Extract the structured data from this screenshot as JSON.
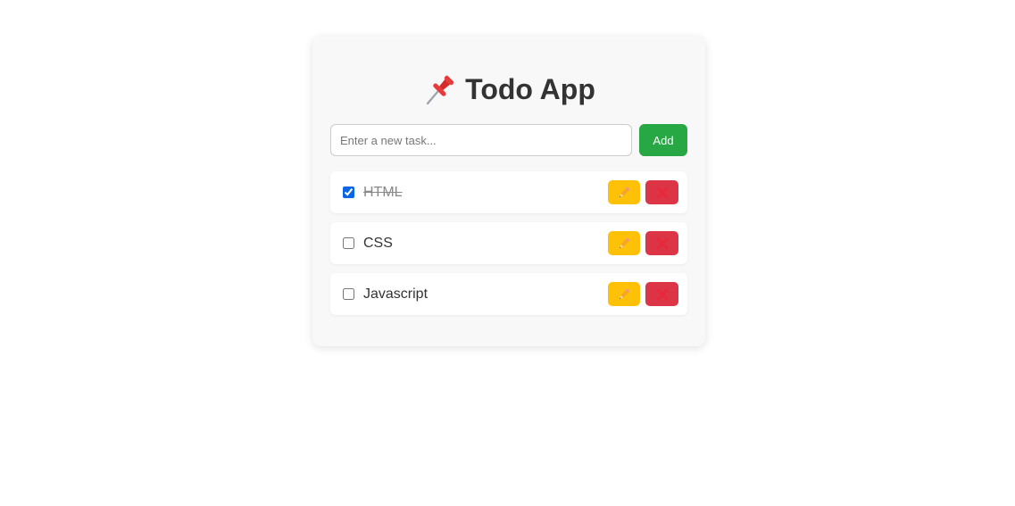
{
  "app": {
    "title": "Todo App",
    "title_icon": "pushpin-icon"
  },
  "input": {
    "placeholder": "Enter a new task...",
    "value": ""
  },
  "add_button": {
    "label": "Add"
  },
  "colors": {
    "add": "#28a745",
    "edit": "#ffc107",
    "delete": "#dc3545",
    "checkbox": "#0a66e4"
  },
  "tasks": [
    {
      "label": "HTML",
      "completed": true,
      "edit_icon": "pencil-icon",
      "delete_icon": "cross-icon"
    },
    {
      "label": "CSS",
      "completed": false,
      "edit_icon": "pencil-icon",
      "delete_icon": "cross-icon"
    },
    {
      "label": "Javascript",
      "completed": false,
      "edit_icon": "pencil-icon",
      "delete_icon": "cross-icon"
    }
  ]
}
